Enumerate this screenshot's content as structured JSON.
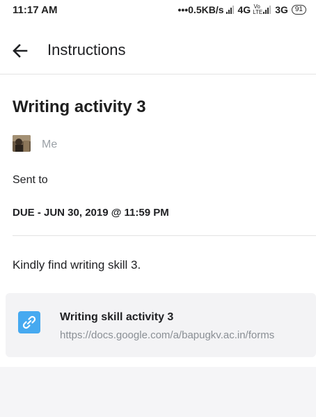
{
  "status_bar": {
    "time": "11:17 AM",
    "network_speed": "•••0.5KB/s",
    "network_1": "4G",
    "volte": "Vo LTE",
    "network_2": "3G",
    "battery": "91"
  },
  "app_bar": {
    "back_icon": "arrow-left-icon",
    "title": "Instructions"
  },
  "assignment": {
    "title": "Writing activity 3",
    "author": "Me",
    "sent_to_label": "Sent to",
    "due": "DUE - JUN 30, 2019 @ 11:59 PM",
    "description": "Kindly find writing skill 3."
  },
  "attachment": {
    "icon": "link-icon",
    "icon_color": "#46a9f0",
    "title": "Writing skill activity  3",
    "url": "https://docs.google.com/a/bapugkv.ac.in/forms"
  }
}
